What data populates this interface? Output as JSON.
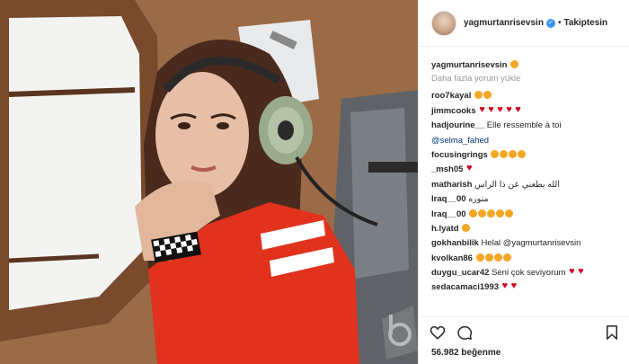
{
  "header": {
    "username": "yagmurtanrisevsin",
    "separator": "•",
    "follow_status": "Takiptesin"
  },
  "caption": {
    "username": "yagmurtanrisevsin"
  },
  "load_more": "Daha fazla yorum yükle",
  "comments": [
    {
      "user": "roo7kayal",
      "text": ""
    },
    {
      "user": "jimmcooks",
      "text": ""
    },
    {
      "user": "hadjourine__",
      "text": "Elle ressemble à toi"
    },
    {
      "user": "",
      "text": "@selma_fahed"
    },
    {
      "user": "focusingrings",
      "text": ""
    },
    {
      "user": "_msh05",
      "text": ""
    },
    {
      "user": "matharish",
      "text": "الله يطعني عن ذا الراس"
    },
    {
      "user": "lraq__00",
      "text": "منوره"
    },
    {
      "user": "lraq__00",
      "text": ""
    },
    {
      "user": "h.lyatd",
      "text": ""
    },
    {
      "user": "gokhanbilik",
      "text": "Helal @yagmurtanrisevsin"
    },
    {
      "user": "kvolkan86",
      "text": ""
    },
    {
      "user": "duygu_ucar42",
      "text": "Seni çok seviyorum"
    },
    {
      "user": "sedacamaci1993",
      "text": ""
    }
  ],
  "likes": {
    "count": "56.982",
    "label": "beğenme"
  },
  "colors": {
    "verified": "#3897f0",
    "link": "#003569",
    "muted": "#999999",
    "jersey": "#e0321c"
  },
  "icons": [
    "heart-outline-icon",
    "comment-icon",
    "bookmark-icon",
    "verified-badge-icon"
  ]
}
